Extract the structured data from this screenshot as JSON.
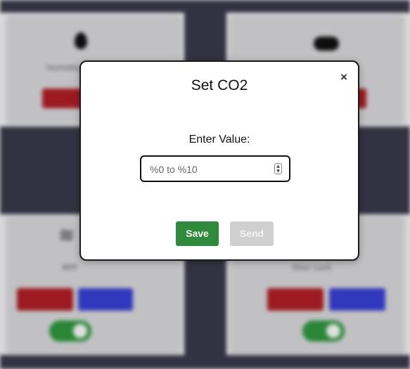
{
  "modal": {
    "title": "Set CO2",
    "close_symbol": "×",
    "field_label": "Enter Value:",
    "input_placeholder": "%0 to %10",
    "input_value": "",
    "save_label": "Save",
    "send_label": "Send",
    "send_disabled": true
  },
  "background": {
    "cards": [
      {
        "icon": "drop-icon",
        "caption": "Humidity"
      },
      {
        "icon": "cloud-icon",
        "caption": ""
      },
      {
        "icon": "wifi-icon",
        "caption": "WiFi"
      },
      {
        "icon": "",
        "caption": "Door Lock"
      }
    ]
  },
  "colors": {
    "save": "#2e8b3b",
    "send_disabled": "#cfcfcf",
    "danger": "#b21e24",
    "primary": "#3840d8",
    "toggle_on": "#2f9a3e",
    "backdrop_dark": "#3a3a4c"
  }
}
